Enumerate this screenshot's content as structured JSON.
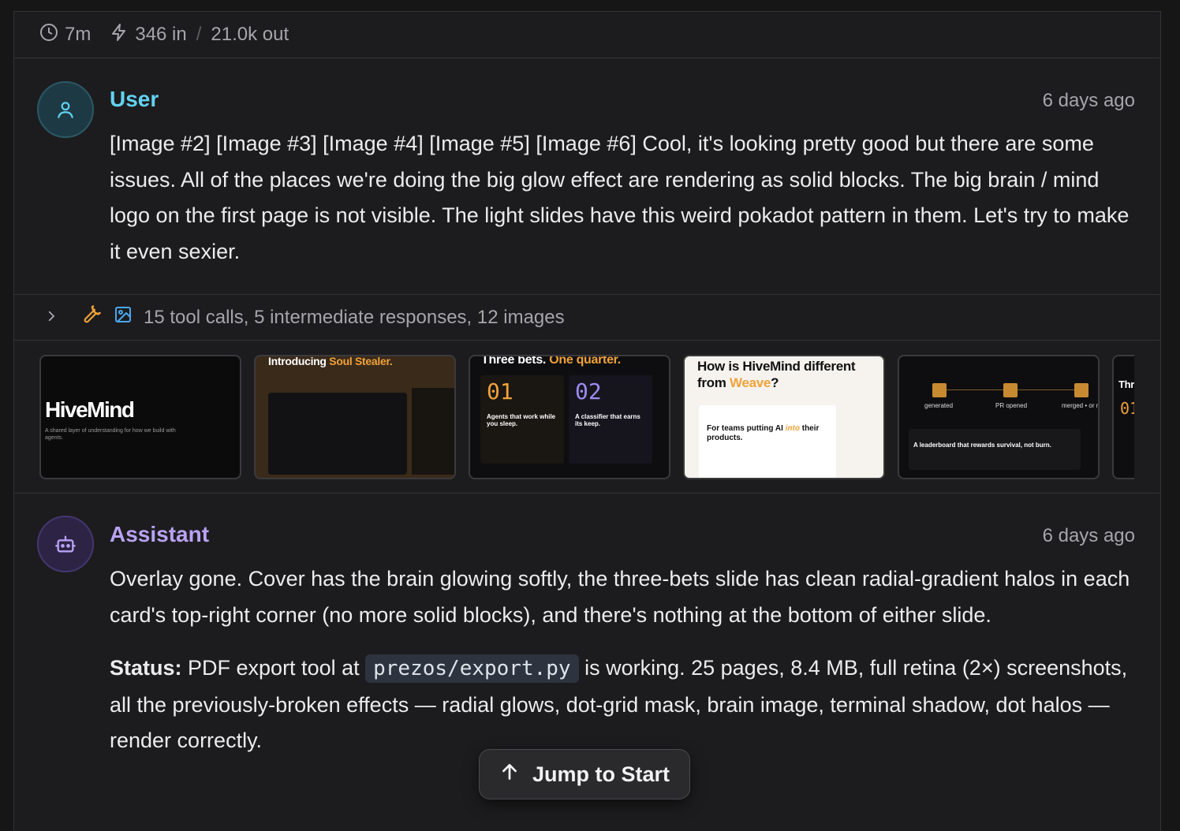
{
  "stats": {
    "duration": "7m",
    "tokens_in": "346 in",
    "separator": "/",
    "tokens_out": "21.0k out"
  },
  "user_message": {
    "role": "User",
    "time": "6 days ago",
    "text": "[Image #2] [Image #3] [Image #4] [Image #5] [Image #6]  Cool, it's looking pretty good but there are some issues.  All of the places we're doing the big glow effect are rendering as solid blocks.  The big brain / mind logo on the first page is not visible.  The light slides have this weird pokadot pattern in them.  Let's try to make it even sexier."
  },
  "tool_summary": {
    "text": "15 tool calls, 5 intermediate responses, 12 images"
  },
  "thumbnails": [
    {
      "title": "HiveMind",
      "subtitle": "A shared layer of understanding for how we build with agents."
    },
    {
      "title_a": "Introducing ",
      "title_b": "Soul Stealer."
    },
    {
      "title_a": "Three bets. ",
      "title_b": "One quarter.",
      "card1_num": "01",
      "card1_text": "Agents that work while you sleep.",
      "card2_num": "02",
      "card2_text": "A classifier that earns its keep."
    },
    {
      "title_a": "How is HiveMind different from ",
      "title_b": "Weave",
      "title_c": "?",
      "card_text_a": "For teams putting AI ",
      "card_text_b": "into",
      "card_text_c": " their products."
    },
    {
      "steps": [
        "generated",
        "PR opened",
        "merged • or no"
      ],
      "card_text": "A leaderboard that rewards survival, not burn."
    },
    {
      "title": "Thre",
      "num": "01"
    }
  ],
  "assistant_message": {
    "role": "Assistant",
    "time": "6 days ago",
    "para1": "Overlay gone. Cover has the brain glowing softly, the three-bets slide has clean radial-gradient halos in each card's top-right corner (no more solid blocks), and there's nothing at the bottom of either slide.",
    "status_label": "Status:",
    "status_pre": " PDF export tool at ",
    "status_code": "prezos/export.py",
    "status_post": " is working. 25 pages, 8.4 MB, full retina (2×) screenshots, all the previously-broken effects — radial glows, dot-grid mask, brain image, terminal shadow, dot halos — render correctly."
  },
  "jump_button": {
    "label": "Jump to Start"
  },
  "colors": {
    "user_accent": "#63d2f0",
    "assistant_accent": "#b9a2f4",
    "orange": "#f0a23a"
  }
}
